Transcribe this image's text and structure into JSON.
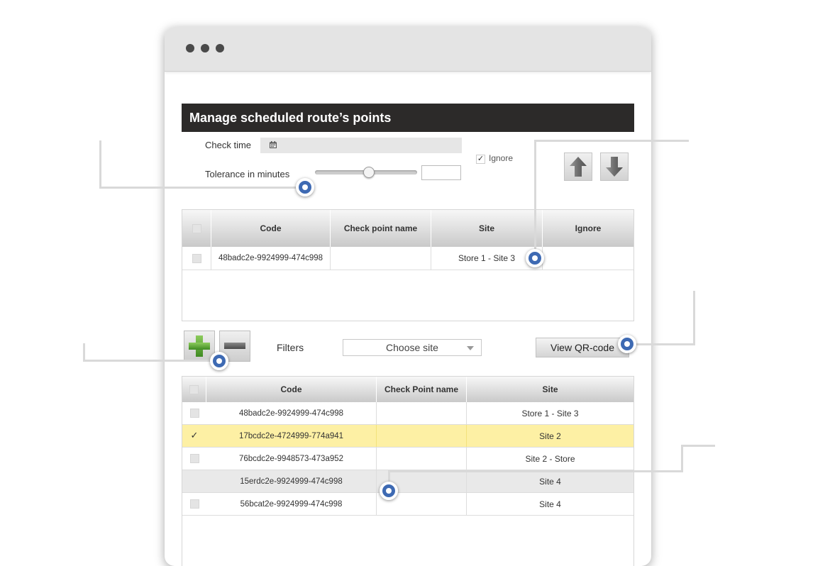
{
  "panel": {
    "title": "Manage scheduled route’s points"
  },
  "form": {
    "check_time_label": "Check time",
    "tolerance_label": "Tolerance in minutes",
    "ignore_label": "Ignore",
    "ignore_checked": true,
    "tolerance_slider_fraction": 0.53
  },
  "top_table": {
    "columns": [
      "Code",
      "Check point name",
      "Site",
      "Ignore"
    ],
    "rows": [
      {
        "code": "48badc2e-9924999-474c998",
        "name": "",
        "site": "Store 1 - Site 3",
        "ignore": ""
      }
    ]
  },
  "toolbar": {
    "filters_label": "Filters",
    "site_select_value": "Choose site",
    "view_qr_label": "View QR-code"
  },
  "bottom_table": {
    "columns": [
      "Code",
      "Check Point name",
      "Site"
    ],
    "rows": [
      {
        "code": "48badc2e-9924999-474c998",
        "name": "",
        "site": "Store 1 - Site 3",
        "checked": false,
        "state": "normal"
      },
      {
        "code": "17bcdc2e-4724999-774a941",
        "name": "",
        "site": "Site 2",
        "checked": true,
        "state": "selected"
      },
      {
        "code": "76bcdc2e-9948573-473a952",
        "name": "",
        "site": "Site 2 - Store",
        "checked": false,
        "state": "normal"
      },
      {
        "code": "15erdc2e-9924999-474c998",
        "name": "",
        "site": "Site 4",
        "checked": false,
        "state": "hover"
      },
      {
        "code": "56bcat2e-9924999-474c998",
        "name": "",
        "site": "Site 4",
        "checked": false,
        "state": "normal"
      }
    ]
  },
  "icons": {
    "calendar": "calendar-icon",
    "up": "arrow-up-icon",
    "down": "arrow-down-icon",
    "add": "plus-icon",
    "remove": "minus-icon",
    "caret": "chevron-down-icon"
  },
  "colors": {
    "header_bg": "#2c2a29",
    "selected_row": "#fdf0a4",
    "marker": "#3e6ab3",
    "add_green": "#5a9e35"
  }
}
